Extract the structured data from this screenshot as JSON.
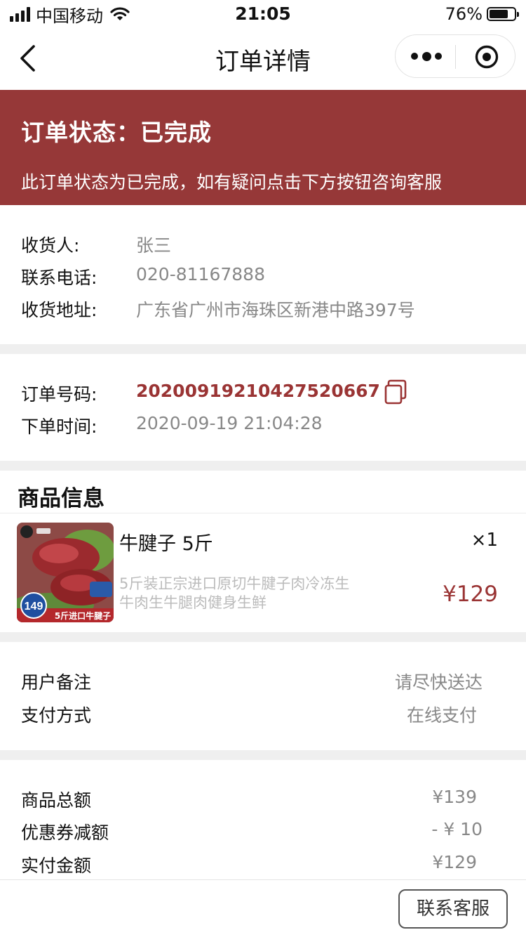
{
  "status_bar": {
    "carrier": "中国移动",
    "time": "21:05",
    "battery_percent": "76%",
    "battery_level": 0.76
  },
  "nav": {
    "title": "订单详情",
    "icons": [
      "chevron-left-icon",
      "more-dots-icon",
      "close-target-icon"
    ]
  },
  "order_status": {
    "title": "订单状态：已完成",
    "description": "此订单状态为已完成，如有疑问点击下方按钮咨询客服",
    "background_color": "#963838"
  },
  "recipient": {
    "name_label": "收货人:",
    "name": "张三",
    "phone_label": "联系电话:",
    "phone": "020-81167888",
    "address_label": "收货地址:",
    "address": "广东省广州市海珠区新港中路397号"
  },
  "order": {
    "number_label": "订单号码:",
    "number": "20200919210427520667",
    "time_label": "下单时间:",
    "time": "2020-09-19 21:04:28",
    "accent_color": "#9a3434"
  },
  "goods": {
    "section_title": "商品信息",
    "items": [
      {
        "name": "牛腱子 5斤",
        "quantity": "×1",
        "description": "5斤装正宗进口原切牛腱子肉冷冻生牛肉生牛腿肉健身生鲜",
        "price": "¥129",
        "image_badge_price": "149",
        "image_caption": "5斤进口牛腱子"
      }
    ]
  },
  "remarks": {
    "note_label": "用户备注",
    "note": "请尽快送达",
    "payment_label": "支付方式",
    "payment": "在线支付"
  },
  "totals": {
    "subtotal_label": "商品总额",
    "subtotal": "¥139",
    "coupon_label": "优惠券减额",
    "coupon": "- ¥ 10",
    "paid_label": "实付金额",
    "paid": "¥129"
  },
  "footer": {
    "contact_button": "联系客服"
  }
}
